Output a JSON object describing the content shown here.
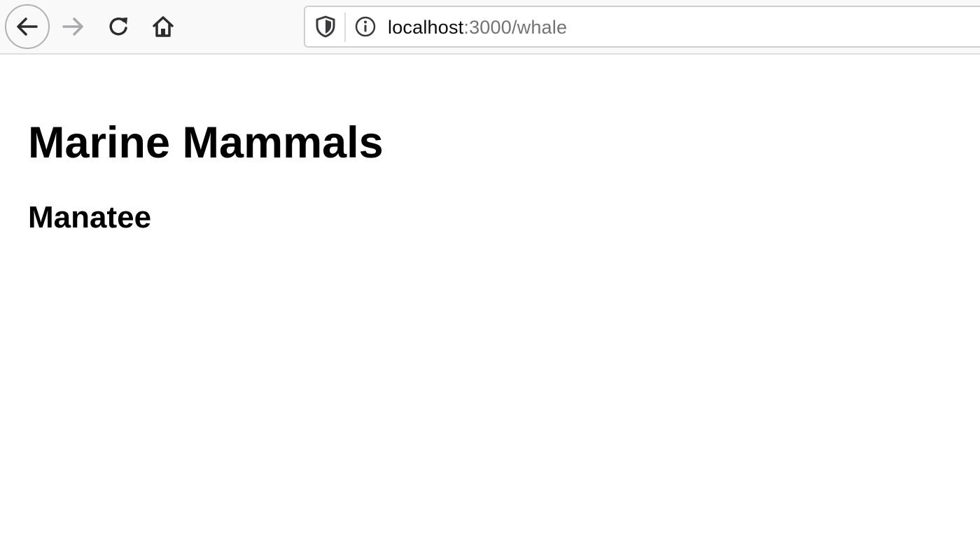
{
  "browser": {
    "url_host": "localhost",
    "url_rest": ":3000/whale",
    "buttons": {
      "back": "back-arrow-icon",
      "forward": "forward-arrow-icon",
      "reload": "reload-icon",
      "home": "home-icon"
    },
    "urlbar_icons": [
      "shield-icon",
      "info-icon"
    ]
  },
  "page": {
    "heading": "Marine Mammals",
    "subheading": "Manatee"
  }
}
